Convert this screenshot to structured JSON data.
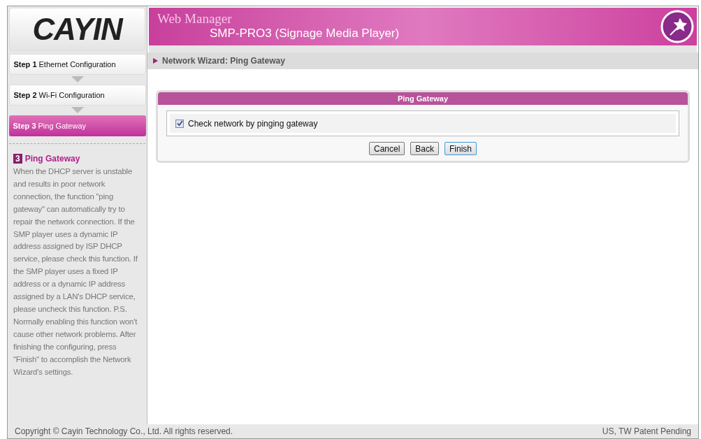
{
  "logo": "CAYIN",
  "header": {
    "title": "Web Manager",
    "subtitle": "SMP-PRO3 (Signage Media Player)"
  },
  "steps": [
    {
      "number": "Step 1",
      "label": "Ethernet Configuration",
      "selected": false
    },
    {
      "number": "Step 2",
      "label": "Wi-Fi Configuration",
      "selected": false
    },
    {
      "number": "Step 3",
      "label": "Ping Gateway",
      "selected": true
    }
  ],
  "help": {
    "badge": "3",
    "title": "Ping Gateway",
    "body": "When the DHCP server is unstable and results in poor network connection, the function \"ping gateway\" can automatically try to repair the network connection. If the SMP player uses a dynamic IP address assigned by ISP DHCP service, please check this function. If the SMP player uses a fixed IP address or a dynamic IP address assigned by a LAN's DHCP service, please uncheck this function. P.S. Normally enabling this function won't cause other network problems. After finishing the configuring, press \"Finish\" to accomplish the Network Wizard's settings."
  },
  "breadcrumb": "Network Wizard: Ping Gateway",
  "panel": {
    "title": "Ping Gateway",
    "option": {
      "label": "Check network by pinging gateway",
      "checked": true
    }
  },
  "buttons": [
    {
      "label": "Cancel",
      "focused": false
    },
    {
      "label": "Back",
      "focused": false
    },
    {
      "label": "Finish",
      "focused": true
    }
  ],
  "footer": {
    "copyright": "Copyright © Cayin Technology Co., Ltd. All rights reserved.",
    "patent": "US, TW Patent Pending"
  }
}
